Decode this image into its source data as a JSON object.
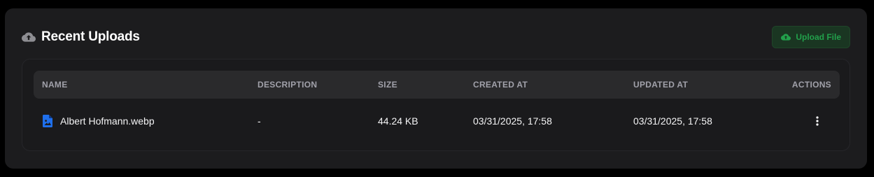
{
  "header": {
    "title": "Recent Uploads",
    "title_icon": "cloud-upload-icon",
    "upload_button_label": "Upload File",
    "upload_button_icon": "cloud-upload-icon"
  },
  "table": {
    "columns": {
      "name": "NAME",
      "description": "DESCRIPTION",
      "size": "SIZE",
      "created_at": "CREATED AT",
      "updated_at": "UPDATED AT",
      "actions": "ACTIONS"
    },
    "rows": [
      {
        "icon": "image-file-icon",
        "name": "Albert Hofmann.webp",
        "description": "-",
        "size": "44.24 KB",
        "created_at": "03/31/2025, 17:58",
        "updated_at": "03/31/2025, 17:58",
        "actions_icon": "more-vertical-icon"
      }
    ]
  },
  "colors": {
    "background": "#000000",
    "card": "#1c1c1e",
    "header_row": "#2a2a2c",
    "accent_green": "#22a04b",
    "file_icon_blue": "#1f6feb",
    "muted_text": "#a1a1aa"
  }
}
